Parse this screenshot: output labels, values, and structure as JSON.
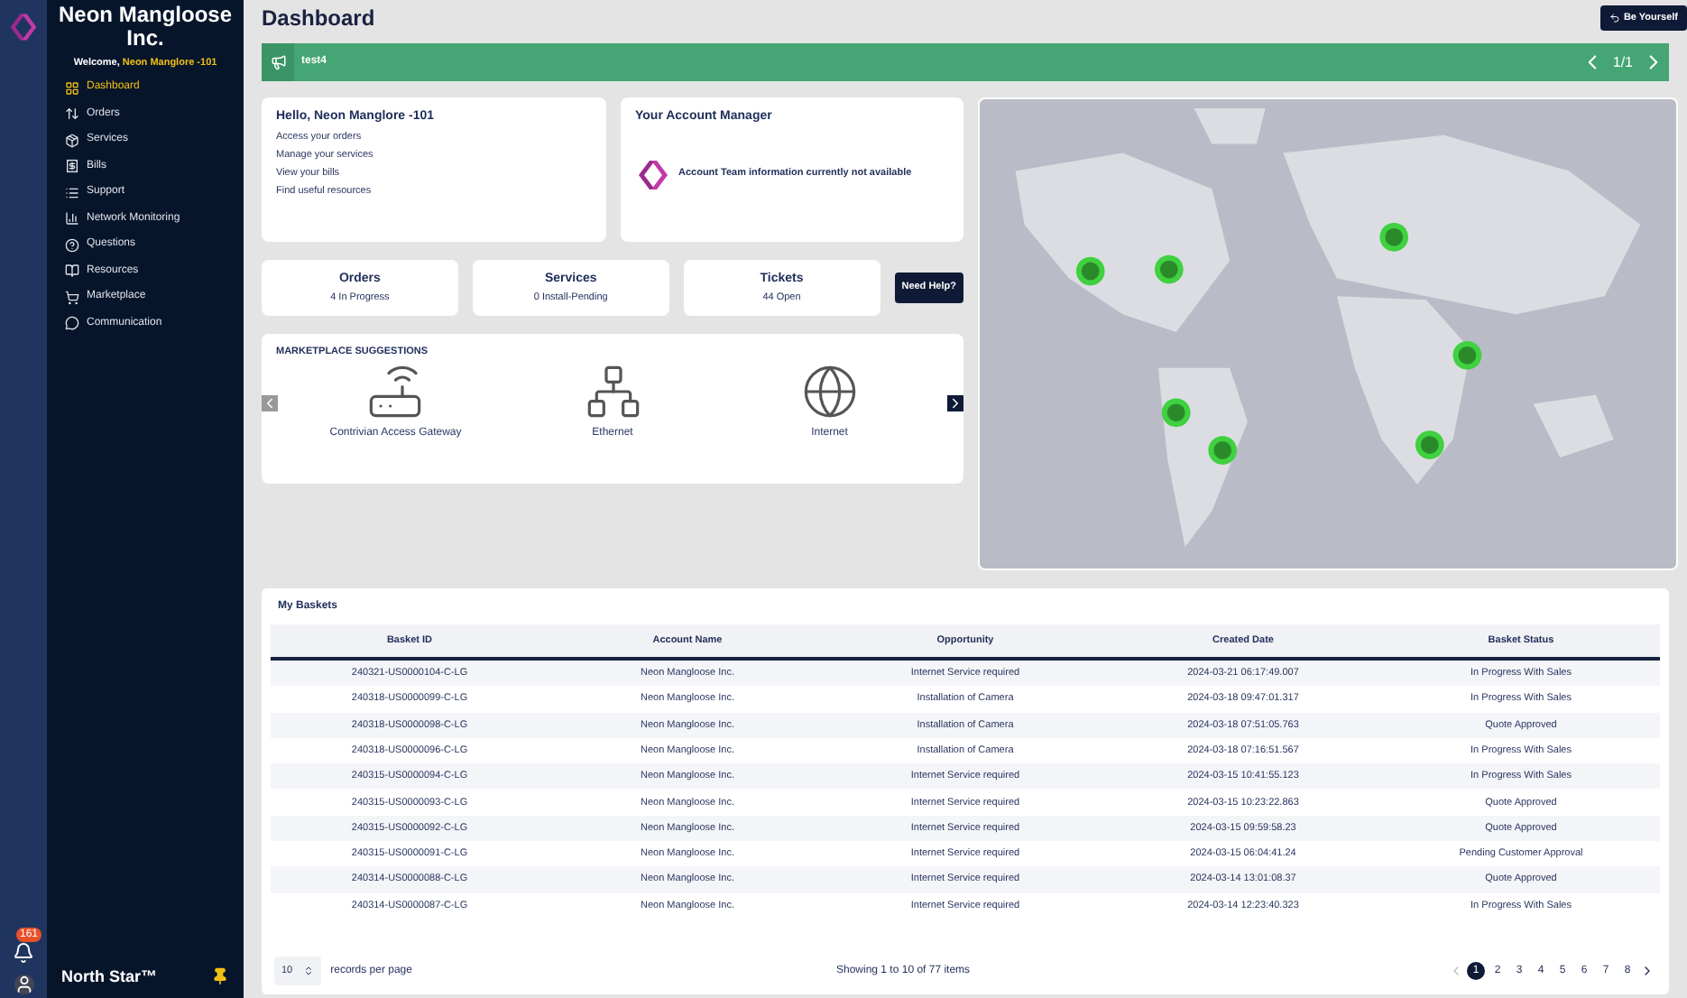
{
  "sidebar": {
    "company": "Neon Mangloose Inc.",
    "welcome": "Welcome,",
    "user": "Neon Manglore -101",
    "items": [
      {
        "label": "Dashboard",
        "selected": true
      },
      {
        "label": "Orders",
        "selected": false
      },
      {
        "label": "Services",
        "selected": false
      },
      {
        "label": "Bills",
        "selected": false
      },
      {
        "label": "Support",
        "selected": false
      },
      {
        "label": "Network Monitoring",
        "selected": false
      },
      {
        "label": "Questions",
        "selected": false
      },
      {
        "label": "Resources",
        "selected": false
      },
      {
        "label": "Marketplace",
        "selected": false
      },
      {
        "label": "Communication",
        "selected": false
      }
    ],
    "notification_count": "161",
    "footer": "North Star™"
  },
  "header": {
    "title": "Dashboard",
    "be_yourself": "Be Yourself"
  },
  "banner": {
    "text": "test4",
    "pager": "1/1"
  },
  "hello": {
    "title": "Hello, Neon Manglore -101",
    "links": [
      "Access your orders",
      "Manage your services",
      "View your bills",
      "Find useful resources"
    ]
  },
  "account_manager": {
    "title": "Your Account Manager",
    "message": "Account Team information currently not available"
  },
  "stats": [
    {
      "title": "Orders",
      "value": "4 In Progress"
    },
    {
      "title": "Services",
      "value": "0 Install-Pending"
    },
    {
      "title": "Tickets",
      "value": "44 Open"
    }
  ],
  "need_help": "Need Help?",
  "marketplace": {
    "title": "MARKETPLACE SUGGESTIONS",
    "items": [
      "Contrivian Access Gateway",
      "Ethernet",
      "Internet"
    ]
  },
  "baskets": {
    "title": "My Baskets",
    "columns": [
      "Basket ID",
      "Account Name",
      "Opportunity",
      "Created Date",
      "Basket Status"
    ],
    "rows": [
      [
        "240321-US0000104-C-LG",
        "Neon Mangloose Inc.",
        "Internet Service required",
        "2024-03-21 06:17:49.007",
        "In Progress With Sales"
      ],
      [
        "240318-US0000099-C-LG",
        "Neon Mangloose Inc.",
        "Installation of Camera",
        "2024-03-18 09:47:01.317",
        "In Progress With Sales"
      ],
      [
        "240318-US0000098-C-LG",
        "Neon Mangloose Inc.",
        "Installation of Camera",
        "2024-03-18 07:51:05.763",
        "Quote Approved"
      ],
      [
        "240318-US0000096-C-LG",
        "Neon Mangloose Inc.",
        "Installation of Camera",
        "2024-03-18 07:16:51.567",
        "In Progress With Sales"
      ],
      [
        "240315-US0000094-C-LG",
        "Neon Mangloose Inc.",
        "Internet Service required",
        "2024-03-15 10:41:55.123",
        "In Progress With Sales"
      ],
      [
        "240315-US0000093-C-LG",
        "Neon Mangloose Inc.",
        "Internet Service required",
        "2024-03-15 10:23:22.863",
        "Quote Approved"
      ],
      [
        "240315-US0000092-C-LG",
        "Neon Mangloose Inc.",
        "Internet Service required",
        "2024-03-15 09:59:58.23",
        "Quote Approved"
      ],
      [
        "240315-US0000091-C-LG",
        "Neon Mangloose Inc.",
        "Internet Service required",
        "2024-03-15 06:04:41.24",
        "Pending Customer Approval"
      ],
      [
        "240314-US0000088-C-LG",
        "Neon Mangloose Inc.",
        "Internet Service required",
        "2024-03-14 13:01:08.37",
        "Quote Approved"
      ],
      [
        "240314-US0000087-C-LG",
        "Neon Mangloose Inc.",
        "Internet Service required",
        "2024-03-14 12:23:40.323",
        "In Progress With Sales"
      ]
    ],
    "page_size": "10",
    "page_size_label": "records per page",
    "showing": "Showing 1 to 10 of 77 items",
    "pages": [
      {
        "label": "1",
        "selected": true
      },
      {
        "label": "2",
        "selected": false
      },
      {
        "label": "3",
        "selected": false
      },
      {
        "label": "4",
        "selected": false
      },
      {
        "label": "5",
        "selected": false
      },
      {
        "label": "6",
        "selected": false
      },
      {
        "label": "7",
        "selected": false
      },
      {
        "label": "8",
        "selected": false
      }
    ]
  }
}
